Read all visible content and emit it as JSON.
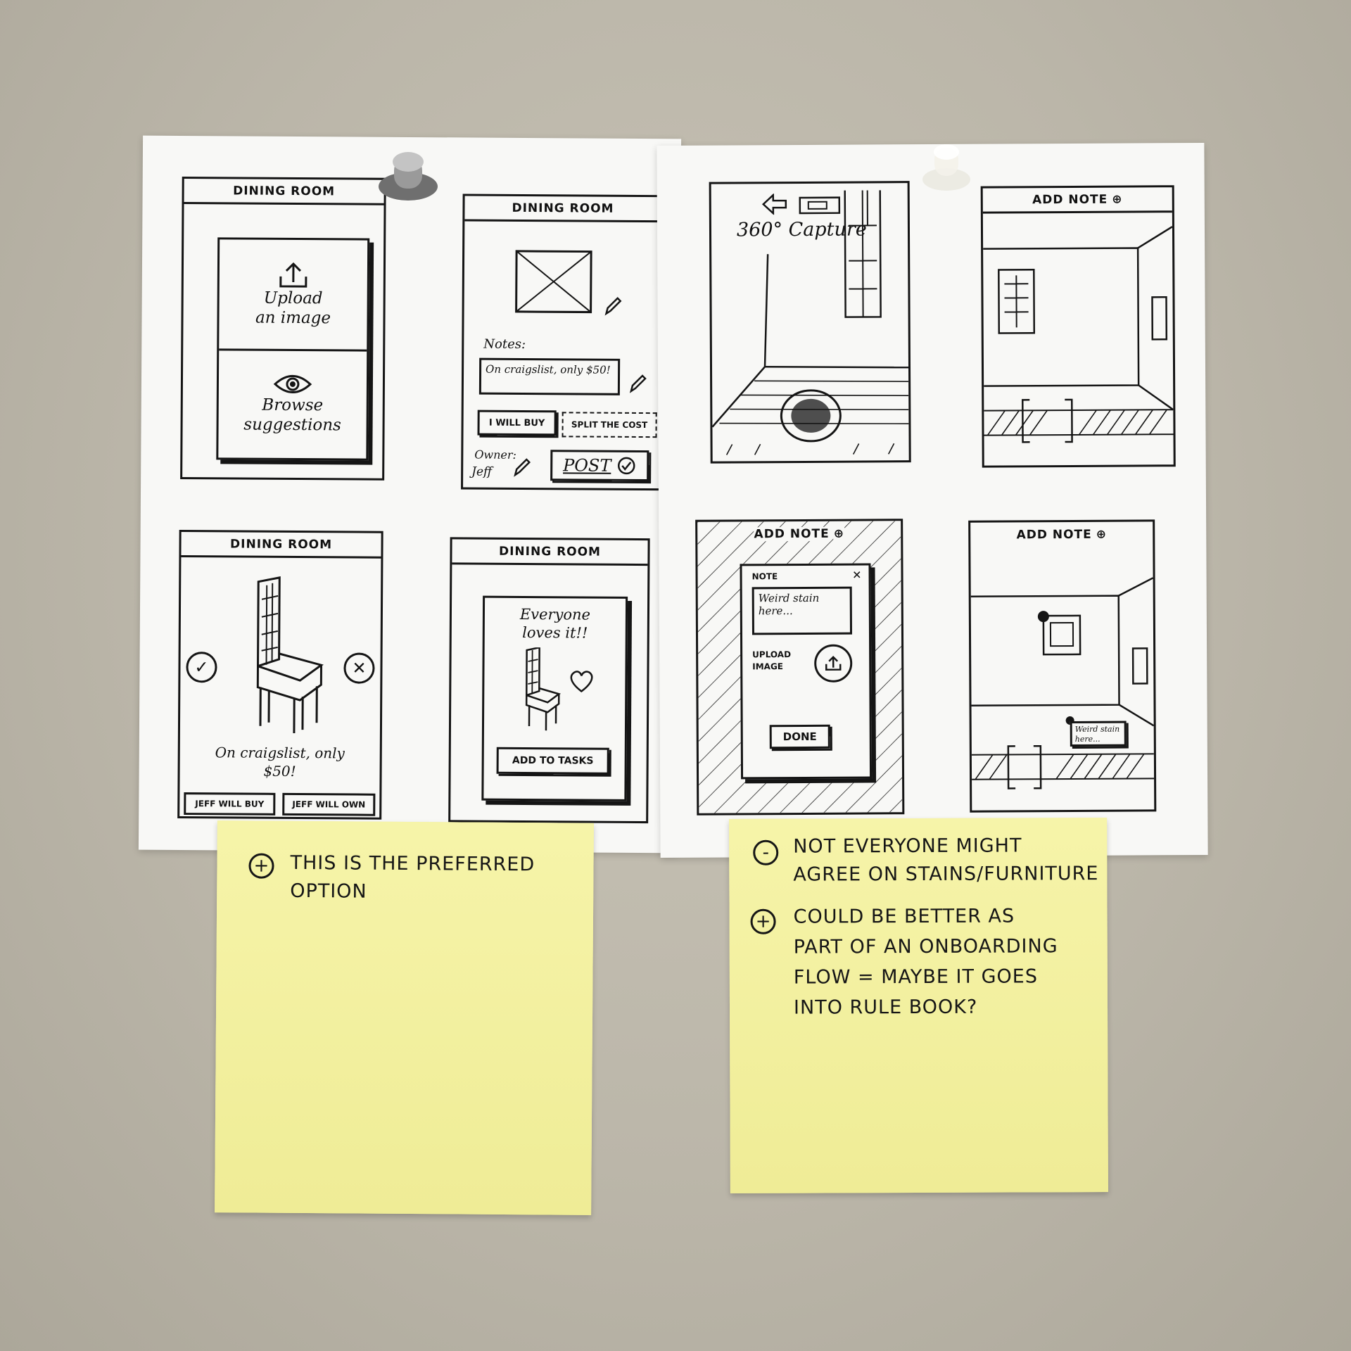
{
  "sketches": {
    "dining_room_title": "DINING ROOM",
    "frame1": {
      "upload_line1": "Upload",
      "upload_line2": "an image",
      "browse_line1": "Browse",
      "browse_line2": "suggestions"
    },
    "frame2": {
      "notes_label": "Notes:",
      "notes_text": "On craigslist, only $50!",
      "i_will_buy": "I WILL BUY",
      "split_cost": "SPLIT THE COST",
      "owner_label": "Owner:",
      "owner_value": "Jeff",
      "post": "POST"
    },
    "frame3": {
      "line1": "On craigslist, only",
      "line2": "$50!",
      "btn_buy": "JEFF WILL BUY",
      "btn_own": "JEFF WILL OWN"
    },
    "frame4": {
      "line1": "Everyone",
      "line2": "loves it!!",
      "add_to_tasks": "ADD TO TASKS"
    },
    "frame5": {
      "capture": "360° Capture"
    },
    "add_note": "ADD NOTE",
    "frame7": {
      "modal_title": "NOTE",
      "note_text": "Weird stain here...",
      "upload_line1": "UPLOAD",
      "upload_line2": "IMAGE",
      "done": "DONE"
    },
    "frame8": {
      "pin_note": "Weird stain here..."
    }
  },
  "sticky_left": {
    "symbol": "+",
    "lines": [
      "THIS IS THE PREFERRED",
      "OPTION"
    ]
  },
  "sticky_right": {
    "minus_symbol": "-",
    "plus_symbol": "+",
    "minus_lines": [
      "NOT EVERYONE MIGHT",
      "AGREE ON STAINS/FURNITURE"
    ],
    "plus_lines": [
      "COULD BE BETTER AS",
      "PART OF AN ONBOARDING",
      "FLOW = MAYBE IT GOES",
      "INTO RULE BOOK?"
    ]
  }
}
